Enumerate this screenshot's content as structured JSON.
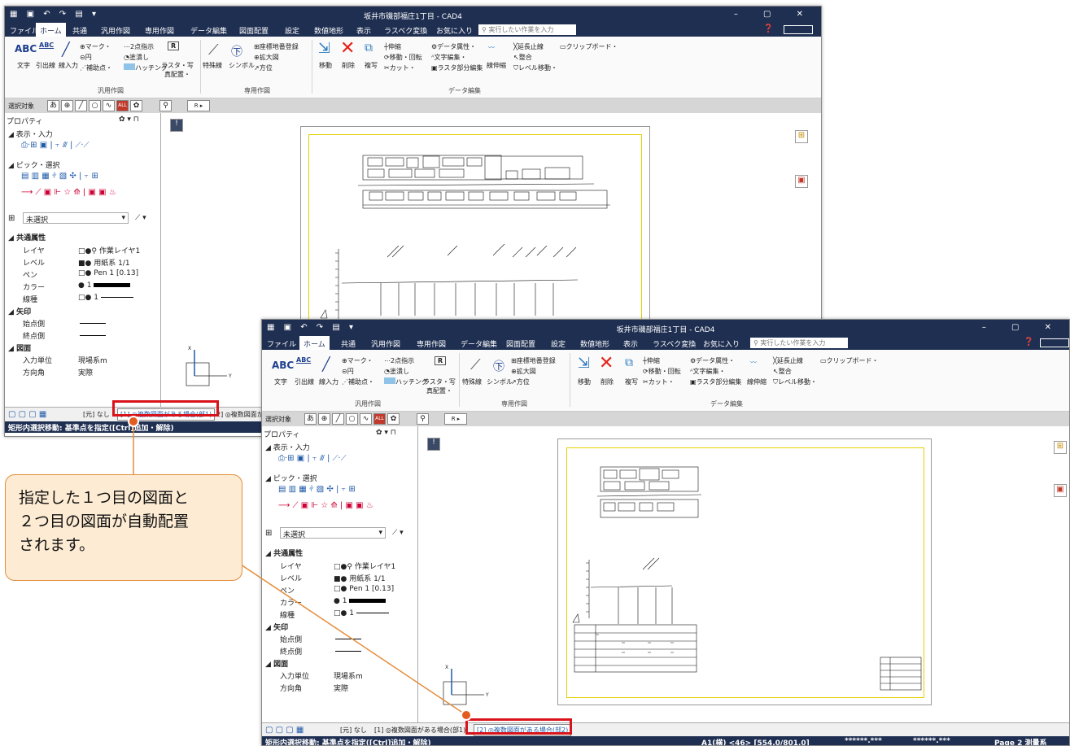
{
  "window1": {
    "title": "坂井市磯部福庄1丁目 - CAD4",
    "tabs": [
      "ファイル",
      "ホーム",
      "共通",
      "汎用作図",
      "専用作図",
      "データ編集",
      "図面配置",
      "設定",
      "数値地形",
      "表示",
      "ラスベク変換",
      "お気に入り"
    ],
    "active_tab": "ホーム",
    "search_placeholder": "実行したい作業を入力",
    "ribbon": {
      "text_btn": "文字",
      "leader_btn": "引出線",
      "line_input_btn": "線入力",
      "mark": "マーク・",
      "circle": "円",
      "aux_point": "補助点・",
      "two_point": "2点指示",
      "fill": "塗潰し",
      "hatching": "ハッチング",
      "raster": "ラスタ・写真配置・",
      "special_line": "特殊線",
      "symbol": "シンボル",
      "parcel_number": "座標地番登録",
      "enlarge": "拡大図",
      "direction": "方位",
      "move": "移動",
      "delete": "削除",
      "copy": "複写",
      "stretch": "伸縮",
      "move_rotate": "移動・回転",
      "cut": "カット・",
      "data_attr": "データ属性・",
      "text_edit": "文字編集・",
      "raster_part_edit": "ラスタ部分編集",
      "extend_stop": "延長止線",
      "align": "整合",
      "level_move": "レベル移動・",
      "line_stretch": "線伸縮",
      "clipboard": "クリップボード・",
      "group_general": "汎用作図",
      "group_special": "専用作図",
      "group_data": "データ編集"
    },
    "selection_label": "選択対象",
    "properties": {
      "header": "プロパティ",
      "display_input": "表示・入力",
      "pick_select": "ピック・選択",
      "unselected": "未選択",
      "common_attr": "共通属性",
      "rows": [
        {
          "k": "レイヤ",
          "v": "作業レイヤ1"
        },
        {
          "k": "レベル",
          "v": "用紙系 1/1"
        },
        {
          "k": "ペン",
          "v": "Pen 1 [0.13]"
        },
        {
          "k": "カラー",
          "v": "1"
        },
        {
          "k": "線種",
          "v": "1"
        }
      ],
      "arrow": "矢印",
      "start_side": "始点側",
      "end_side": "終点側",
      "drawing": "図面",
      "input_unit_k": "入力単位",
      "input_unit_v": "現場系m",
      "direction_k": "方向角",
      "direction_v": "実際"
    },
    "bottom_tabs": [
      "[元] なし",
      "[1] ◎複数図面がある場合(部1)",
      "2] ◎複数図面か"
    ],
    "status": "矩形内選択移動: 基準点を指定([Ctrl]追加・解除)"
  },
  "window2": {
    "title": "坂井市磯部福庄1丁目 - CAD4",
    "bottom_tabs": [
      "[元] なし",
      "[1] ◎複数図面がある場合(部1)",
      "[2] ◎複数図面がある場合(部2)"
    ],
    "status": "矩形内選択移動: 基準点を指定([Ctrl]追加・解除)",
    "status_right": {
      "paper": "A1(横) <46> [554.0/801.0]",
      "coord1": "******.***",
      "coord2": "******.***",
      "page": "Page 2 測量系"
    }
  },
  "callout": {
    "line1": "指定した１つ目の図面と",
    "line2": "２つ目の図面が自動配置",
    "line3": "されます。"
  },
  "colors": {
    "titlebar": "#1f2f52",
    "highlight": "#d9131b",
    "callout_bg": "#fdebd3",
    "callout_border": "#e28d3c",
    "dot": "#e35b1f"
  }
}
